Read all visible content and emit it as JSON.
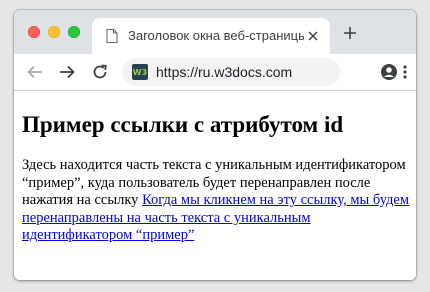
{
  "tab": {
    "title": "Заголовок окна веб-страницы",
    "icon": "page-icon"
  },
  "toolbar": {
    "url": "https://ru.w3docs.com",
    "site_icon_text": "W3"
  },
  "page": {
    "heading": "Пример ссылки с атрибутом id",
    "paragraph_text": "Здесь находится часть текста с уникальным идентификатором “пример”, куда пользователь будет перенаправлен после нажатия на ссылку",
    "link_text": "Когда мы кликнем на эту ссылку, мы будем перенаправлены на часть текста с уникальным идентификатором “пример”"
  },
  "colors": {
    "tabstrip": "#dee1e6",
    "link": "#0000ee",
    "close": "#ff5f57",
    "minimize": "#febc2e",
    "maximize": "#28c840"
  }
}
